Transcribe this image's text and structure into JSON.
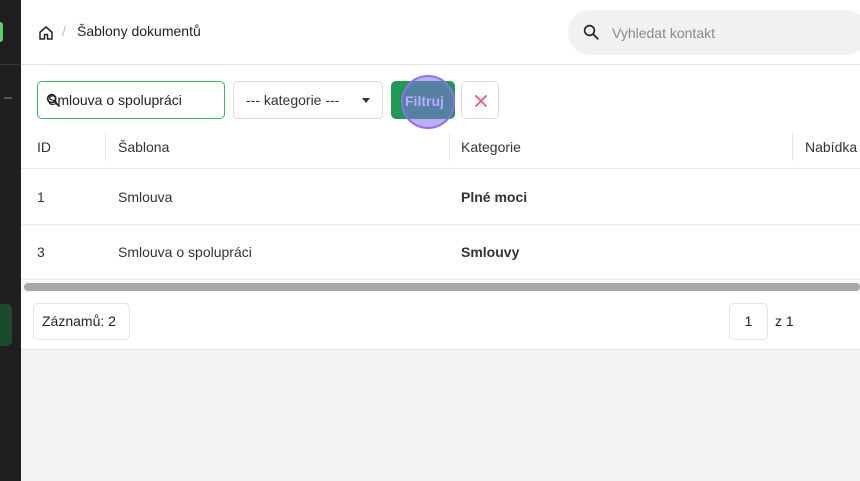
{
  "header": {
    "breadcrumb_sep": "/",
    "title": "Šablony dokumentů",
    "search_placeholder": "Vyhledat kontakt"
  },
  "filters": {
    "search_value": "Smlouva o spolupráci",
    "category_selected": "--- kategorie ---",
    "filter_button": "Filtruj",
    "clear_button": "✕"
  },
  "table": {
    "columns": [
      "ID",
      "Šablona",
      "Kategorie",
      "Nabídka"
    ],
    "rows": [
      {
        "id": "1",
        "template": "Smlouva",
        "category": "Plné moci"
      },
      {
        "id": "3",
        "template": "Smlouva o spolupráci",
        "category": "Smlouvy"
      }
    ]
  },
  "footer": {
    "records": "Záznamů: 2",
    "page": "1",
    "of": "z 1"
  },
  "colors": {
    "accent": "#1f9a52",
    "input_border": "#39b86a",
    "clear_x": "#e05a7a",
    "sidebar": "#1f1f1f"
  }
}
